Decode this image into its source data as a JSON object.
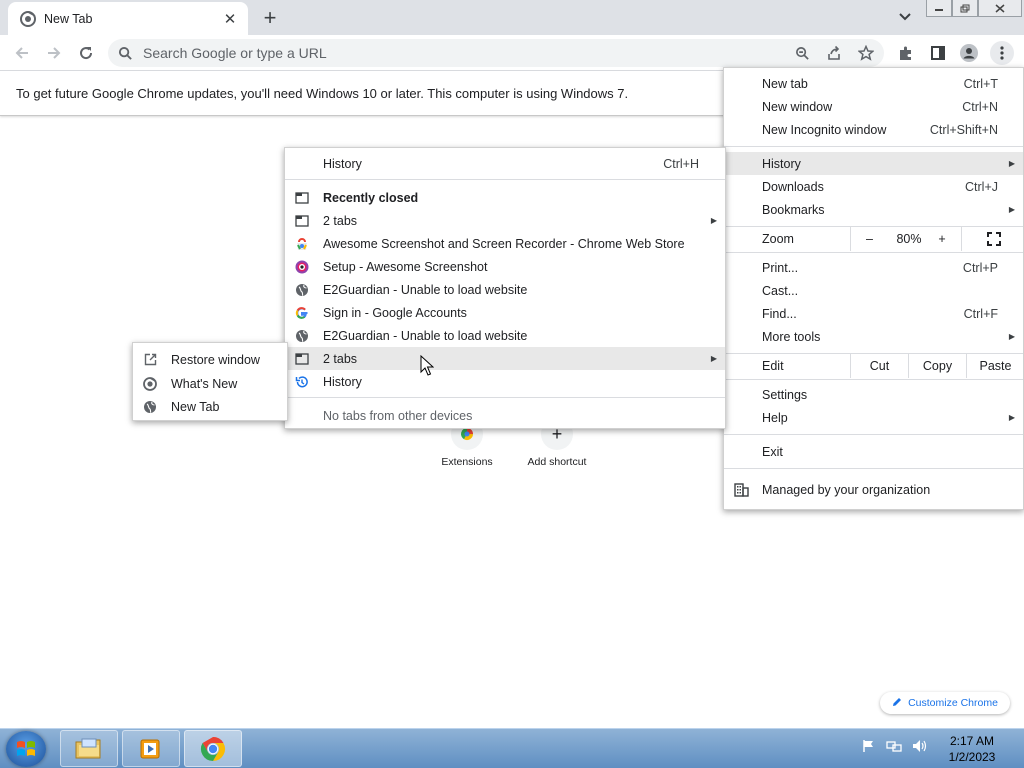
{
  "window": {
    "tab_title": "New Tab",
    "tab_close": "✕",
    "new_tab_plus": "+"
  },
  "toolbar": {
    "omnibox_placeholder": "Search Google or type a URL"
  },
  "infobar": {
    "message": "To get future Google Chrome updates, you'll need Windows 10 or later. This computer is using Windows 7."
  },
  "ntp": {
    "shortcuts": [
      {
        "label": "Extensions"
      },
      {
        "label": "Add shortcut",
        "icon": "+"
      }
    ],
    "customize_label": "Customize Chrome"
  },
  "main_menu": {
    "items": {
      "new_tab": {
        "label": "New tab",
        "shortcut": "Ctrl+T"
      },
      "new_window": {
        "label": "New window",
        "shortcut": "Ctrl+N"
      },
      "new_incognito": {
        "label": "New Incognito window",
        "shortcut": "Ctrl+Shift+N"
      },
      "history": {
        "label": "History"
      },
      "downloads": {
        "label": "Downloads",
        "shortcut": "Ctrl+J"
      },
      "bookmarks": {
        "label": "Bookmarks"
      },
      "print": {
        "label": "Print...",
        "shortcut": "Ctrl+P"
      },
      "cast": {
        "label": "Cast..."
      },
      "find": {
        "label": "Find...",
        "shortcut": "Ctrl+F"
      },
      "more_tools": {
        "label": "More tools"
      },
      "settings": {
        "label": "Settings"
      },
      "help": {
        "label": "Help"
      },
      "exit": {
        "label": "Exit"
      },
      "managed": {
        "label": "Managed by your organization"
      }
    },
    "zoom": {
      "label": "Zoom",
      "minus": "–",
      "value": "80%",
      "plus": "+"
    },
    "edit": {
      "label": "Edit",
      "cut": "Cut",
      "copy": "Copy",
      "paste": "Paste"
    }
  },
  "history_menu": {
    "header": {
      "label": "History",
      "shortcut": "Ctrl+H"
    },
    "recently_closed": "Recently closed",
    "items": [
      {
        "label": "2 tabs",
        "icon": "window-icon"
      },
      {
        "label": "Awesome Screenshot and Screen Recorder - Chrome Web Store",
        "icon": "webstore-icon"
      },
      {
        "label": "Setup - Awesome Screenshot",
        "icon": "awesome-screenshot-icon"
      },
      {
        "label": "E2Guardian - Unable to load website",
        "icon": "globe-icon"
      },
      {
        "label": "Sign in - Google Accounts",
        "icon": "google-icon"
      },
      {
        "label": "E2Guardian - Unable to load website",
        "icon": "globe-icon"
      },
      {
        "label": "2 tabs",
        "icon": "window-icon"
      },
      {
        "label": "History",
        "icon": "history-icon"
      }
    ],
    "no_tabs": "No tabs from other devices"
  },
  "tabs_submenu": {
    "items": [
      {
        "label": "Restore window",
        "icon": "restore-icon"
      },
      {
        "label": "What's New",
        "icon": "chrome-icon"
      },
      {
        "label": "New Tab",
        "icon": "globe-icon"
      }
    ]
  },
  "taskbar": {
    "time": "2:17 AM",
    "date": "1/2/2023"
  }
}
